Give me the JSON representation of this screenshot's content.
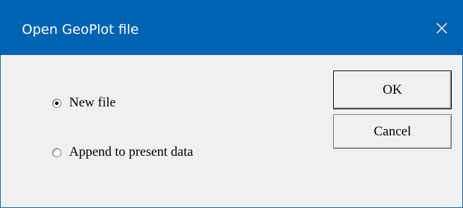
{
  "window": {
    "title": "Open GeoPlot file",
    "close_icon": "close-icon"
  },
  "options": [
    {
      "label": "New file",
      "checked": true
    },
    {
      "label": "Append to present data",
      "checked": false
    }
  ],
  "buttons": {
    "ok_label": "OK",
    "cancel_label": "Cancel"
  },
  "colors": {
    "titlebar": "#0063b1",
    "dialog_bg": "#f0f0f0"
  }
}
